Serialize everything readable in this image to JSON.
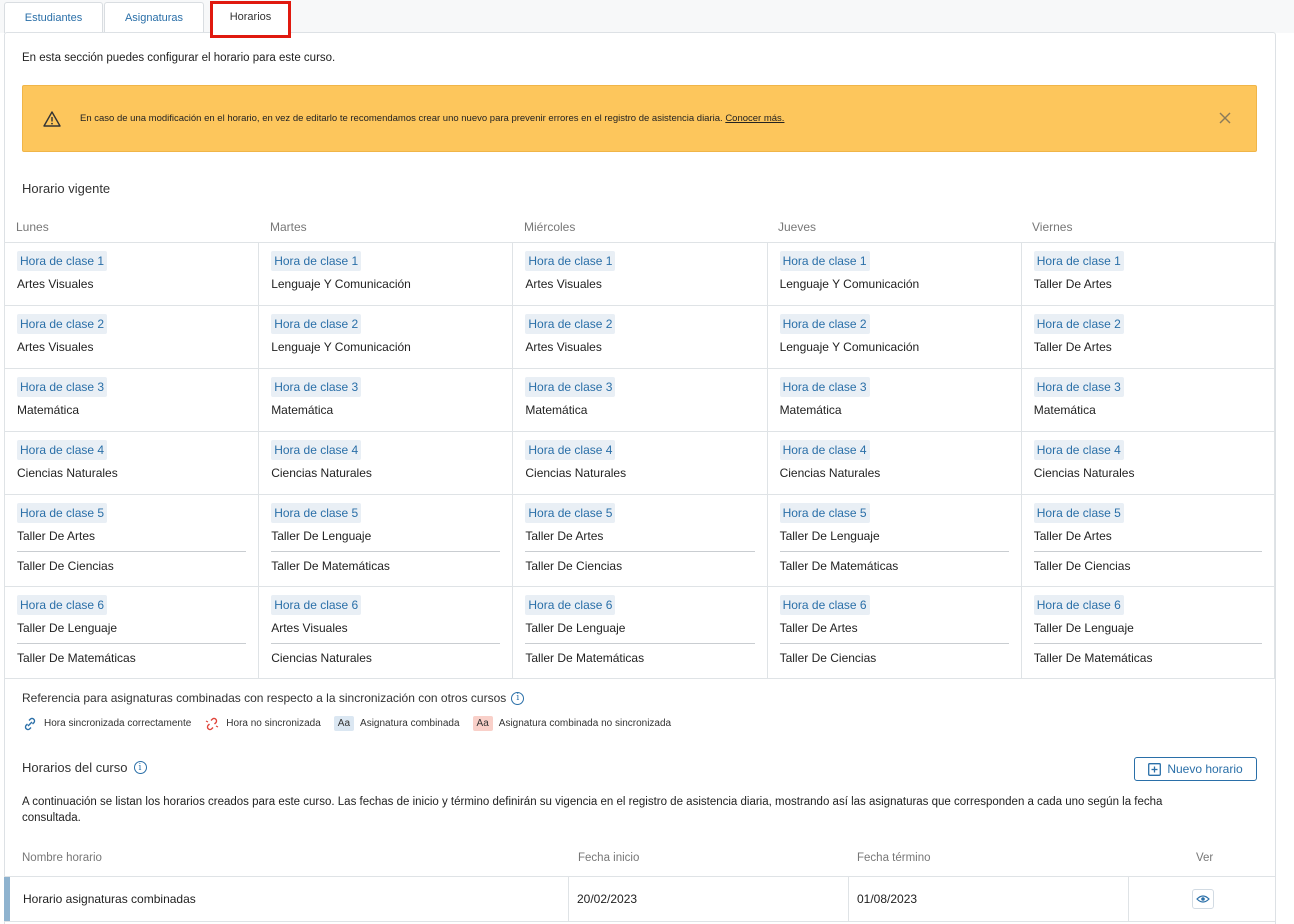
{
  "tabs": [
    "Estudiantes",
    "Asignaturas",
    "Horarios"
  ],
  "intro": "En esta sección puedes configurar el horario para este curso.",
  "alert": {
    "text": "En caso de una modificación en el horario, en vez de editarlo te recomendamos crear uno nuevo para prevenir errores en el registro de asistencia diaria.",
    "link": "Conocer más.",
    "icon": "warning-icon",
    "color": "#fdc65c"
  },
  "current_schedule_title": "Horario vigente",
  "days": [
    "Lunes",
    "Martes",
    "Miércoles",
    "Jueves",
    "Viernes"
  ],
  "schedule": [
    [
      {
        "hora": "Hora de clase 1",
        "subjects": [
          "Artes Visuales"
        ]
      },
      {
        "hora": "Hora de clase 1",
        "subjects": [
          "Lenguaje Y Comunicación"
        ]
      },
      {
        "hora": "Hora de clase 1",
        "subjects": [
          "Artes Visuales"
        ]
      },
      {
        "hora": "Hora de clase 1",
        "subjects": [
          "Lenguaje Y Comunicación"
        ]
      },
      {
        "hora": "Hora de clase 1",
        "subjects": [
          "Taller De Artes"
        ]
      }
    ],
    [
      {
        "hora": "Hora de clase 2",
        "subjects": [
          "Artes Visuales"
        ]
      },
      {
        "hora": "Hora de clase 2",
        "subjects": [
          "Lenguaje Y Comunicación"
        ]
      },
      {
        "hora": "Hora de clase 2",
        "subjects": [
          "Artes Visuales"
        ]
      },
      {
        "hora": "Hora de clase 2",
        "subjects": [
          "Lenguaje Y Comunicación"
        ]
      },
      {
        "hora": "Hora de clase 2",
        "subjects": [
          "Taller De Artes"
        ]
      }
    ],
    [
      {
        "hora": "Hora de clase 3",
        "subjects": [
          "Matemática"
        ]
      },
      {
        "hora": "Hora de clase 3",
        "subjects": [
          "Matemática"
        ]
      },
      {
        "hora": "Hora de clase 3",
        "subjects": [
          "Matemática"
        ]
      },
      {
        "hora": "Hora de clase 3",
        "subjects": [
          "Matemática"
        ]
      },
      {
        "hora": "Hora de clase 3",
        "subjects": [
          "Matemática"
        ]
      }
    ],
    [
      {
        "hora": "Hora de clase 4",
        "subjects": [
          "Ciencias Naturales"
        ]
      },
      {
        "hora": "Hora de clase 4",
        "subjects": [
          "Ciencias Naturales"
        ]
      },
      {
        "hora": "Hora de clase 4",
        "subjects": [
          "Ciencias Naturales"
        ]
      },
      {
        "hora": "Hora de clase 4",
        "subjects": [
          "Ciencias Naturales"
        ]
      },
      {
        "hora": "Hora de clase 4",
        "subjects": [
          "Ciencias Naturales"
        ]
      }
    ],
    [
      {
        "hora": "Hora de clase 5",
        "subjects": [
          "Taller De Artes",
          "Taller De Ciencias"
        ]
      },
      {
        "hora": "Hora de clase 5",
        "subjects": [
          "Taller De Lenguaje",
          "Taller De Matemáticas"
        ]
      },
      {
        "hora": "Hora de clase 5",
        "subjects": [
          "Taller De Artes",
          "Taller De Ciencias"
        ]
      },
      {
        "hora": "Hora de clase 5",
        "subjects": [
          "Taller De Lenguaje",
          "Taller De Matemáticas"
        ]
      },
      {
        "hora": "Hora de clase 5",
        "subjects": [
          "Taller De Artes",
          "Taller De Ciencias"
        ]
      }
    ],
    [
      {
        "hora": "Hora de clase 6",
        "subjects": [
          "Taller De Lenguaje",
          "Taller De Matemáticas"
        ]
      },
      {
        "hora": "Hora de clase 6",
        "subjects": [
          "Artes Visuales",
          "Ciencias Naturales"
        ]
      },
      {
        "hora": "Hora de clase 6",
        "subjects": [
          "Taller De Lenguaje",
          "Taller De Matemáticas"
        ]
      },
      {
        "hora": "Hora de clase 6",
        "subjects": [
          "Taller De Artes",
          "Taller De Ciencias"
        ]
      },
      {
        "hora": "Hora de clase 6",
        "subjects": [
          "Taller De Lenguaje",
          "Taller De Matemáticas"
        ]
      }
    ]
  ],
  "reference": {
    "title": "Referencia para asignaturas combinadas con respecto a la sincronización con otros cursos",
    "items": [
      {
        "icon": "link-icon",
        "label": "Hora sincronizada correctamente"
      },
      {
        "icon": "broken-link-icon",
        "label": "Hora no sincronizada"
      },
      {
        "badge": "Aa",
        "label": "Asignatura combinada"
      },
      {
        "badge": "Aa",
        "label": "Asignatura combinada no sincronizada"
      }
    ]
  },
  "courses": {
    "title": "Horarios del curso",
    "new_button": "Nuevo horario",
    "description": "A continuación se listan los horarios creados para este curso. Las fechas de inicio y término definirán su vigencia en el registro de asistencia diaria, mostrando así las asignaturas que corresponden a cada uno según la fecha consultada.",
    "columns": [
      "Nombre horario",
      "Fecha inicio",
      "Fecha término",
      "Ver"
    ],
    "rows": [
      {
        "name": "Horario asignaturas combinadas",
        "start": "20/02/2023",
        "end": "01/08/2023"
      }
    ]
  },
  "colors": {
    "accent": "#2a6fa8",
    "highlight": "#e0190f"
  }
}
